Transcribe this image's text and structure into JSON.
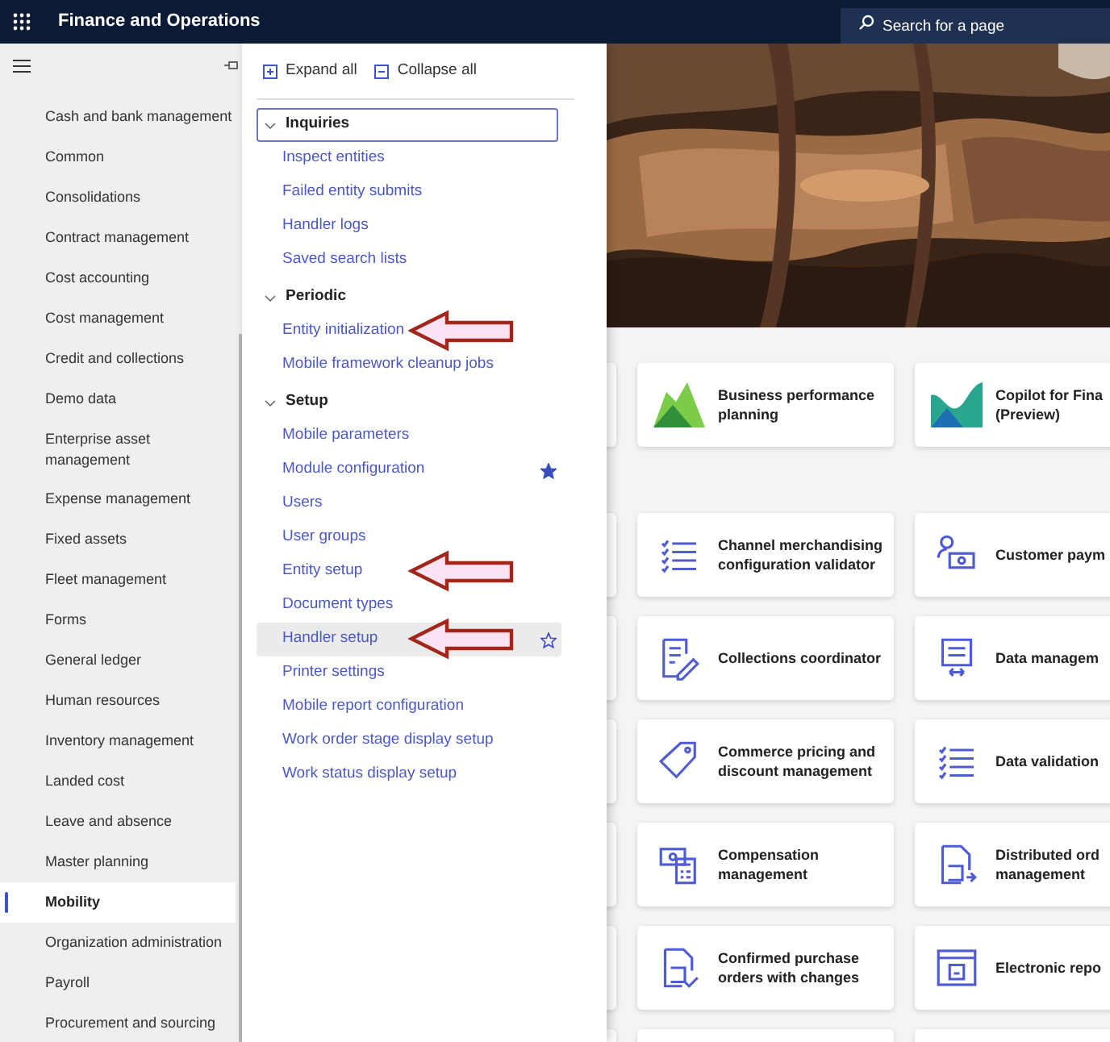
{
  "app": {
    "title": "Finance and Operations",
    "search": {
      "placeholder": "Search for a page"
    }
  },
  "nav": {
    "items": [
      {
        "label": "Cash and bank management",
        "selected": false
      },
      {
        "label": "Common",
        "selected": false
      },
      {
        "label": "Consolidations",
        "selected": false
      },
      {
        "label": "Contract management",
        "selected": false
      },
      {
        "label": "Cost accounting",
        "selected": false
      },
      {
        "label": "Cost management",
        "selected": false
      },
      {
        "label": "Credit and collections",
        "selected": false
      },
      {
        "label": "Demo data",
        "selected": false
      },
      {
        "label": "Enterprise asset management",
        "selected": false
      },
      {
        "label": "Expense management",
        "selected": false
      },
      {
        "label": "Fixed assets",
        "selected": false
      },
      {
        "label": "Fleet management",
        "selected": false
      },
      {
        "label": "Forms",
        "selected": false
      },
      {
        "label": "General ledger",
        "selected": false
      },
      {
        "label": "Human resources",
        "selected": false
      },
      {
        "label": "Inventory management",
        "selected": false
      },
      {
        "label": "Landed cost",
        "selected": false
      },
      {
        "label": "Leave and absence",
        "selected": false
      },
      {
        "label": "Master planning",
        "selected": false
      },
      {
        "label": "Mobility",
        "selected": true
      },
      {
        "label": "Organization administration",
        "selected": false
      },
      {
        "label": "Payroll",
        "selected": false
      },
      {
        "label": "Procurement and sourcing",
        "selected": false
      }
    ]
  },
  "flyout": {
    "toolbar": [
      {
        "kind": "expand",
        "label": "Expand all"
      },
      {
        "kind": "collapse",
        "label": "Collapse all"
      }
    ],
    "groups": [
      {
        "label": "Inquiries",
        "expanded": true,
        "focused": true,
        "links": [
          {
            "label": "Inspect entities",
            "favorite": false,
            "hovered": false,
            "highlighted": false
          },
          {
            "label": "Failed entity submits",
            "favorite": false,
            "hovered": false,
            "highlighted": false
          },
          {
            "label": "Handler logs",
            "favorite": false,
            "hovered": false,
            "highlighted": false
          },
          {
            "label": "Saved search lists",
            "favorite": false,
            "hovered": false,
            "highlighted": false
          }
        ]
      },
      {
        "label": "Periodic",
        "expanded": true,
        "focused": false,
        "links": [
          {
            "label": "Entity initialization",
            "favorite": false,
            "hovered": false,
            "highlighted": true
          },
          {
            "label": "Mobile framework cleanup jobs",
            "favorite": false,
            "hovered": false,
            "highlighted": false
          }
        ]
      },
      {
        "label": "Setup",
        "expanded": true,
        "focused": false,
        "links": [
          {
            "label": "Mobile parameters",
            "favorite": false,
            "hovered": false,
            "highlighted": false
          },
          {
            "label": "Module configuration",
            "favorite": true,
            "hovered": false,
            "highlighted": false
          },
          {
            "label": "Users",
            "favorite": false,
            "hovered": false,
            "highlighted": false
          },
          {
            "label": "User groups",
            "favorite": false,
            "hovered": false,
            "highlighted": false
          },
          {
            "label": "Entity setup",
            "favorite": false,
            "hovered": false,
            "highlighted": true
          },
          {
            "label": "Document types",
            "favorite": false,
            "hovered": false,
            "highlighted": false
          },
          {
            "label": "Handler setup",
            "favorite": false,
            "hovered": true,
            "highlighted": true
          },
          {
            "label": "Printer settings",
            "favorite": false,
            "hovered": false,
            "highlighted": false
          },
          {
            "label": "Mobile report configuration",
            "favorite": false,
            "hovered": false,
            "highlighted": false
          },
          {
            "label": "Work order stage display setup",
            "favorite": false,
            "hovered": false,
            "highlighted": false
          },
          {
            "label": "Work status display setup",
            "favorite": false,
            "hovered": false,
            "highlighted": false
          }
        ]
      }
    ]
  },
  "workspace": {
    "sections": [
      {
        "rows": [
          {
            "tiles": [
              {
                "kind": "hills",
                "lines": [
                  "Business performance",
                  "planning"
                ]
              },
              {
                "kind": "wave",
                "lines": [
                  "Copilot for Fina",
                  "(Preview)"
                ]
              }
            ]
          }
        ]
      },
      {
        "rows": [
          {
            "tiles": [
              {
                "kind": "checklist",
                "lines": [
                  "Channel merchandising",
                  "configuration validator"
                ]
              },
              {
                "kind": "person",
                "lines": [
                  "Customer paym"
                ]
              }
            ]
          },
          {
            "tiles": [
              {
                "kind": "pen",
                "lines": [
                  "Collections coordinator"
                ]
              },
              {
                "kind": "transfer",
                "lines": [
                  "Data managem"
                ]
              }
            ]
          },
          {
            "tiles": [
              {
                "kind": "tag",
                "lines": [
                  "Commerce pricing and",
                  "discount management"
                ]
              },
              {
                "kind": "checklist",
                "lines": [
                  "Data validation"
                ]
              }
            ]
          },
          {
            "tiles": [
              {
                "kind": "calculator",
                "lines": [
                  "Compensation",
                  "management"
                ]
              },
              {
                "kind": "export",
                "lines": [
                  "Distributed ord",
                  "management"
                ]
              }
            ]
          },
          {
            "tiles": [
              {
                "kind": "approval",
                "lines": [
                  "Confirmed purchase",
                  "orders with changes"
                ]
              },
              {
                "kind": "report",
                "lines": [
                  "Electronic repo"
                ]
              }
            ]
          }
        ]
      }
    ]
  }
}
